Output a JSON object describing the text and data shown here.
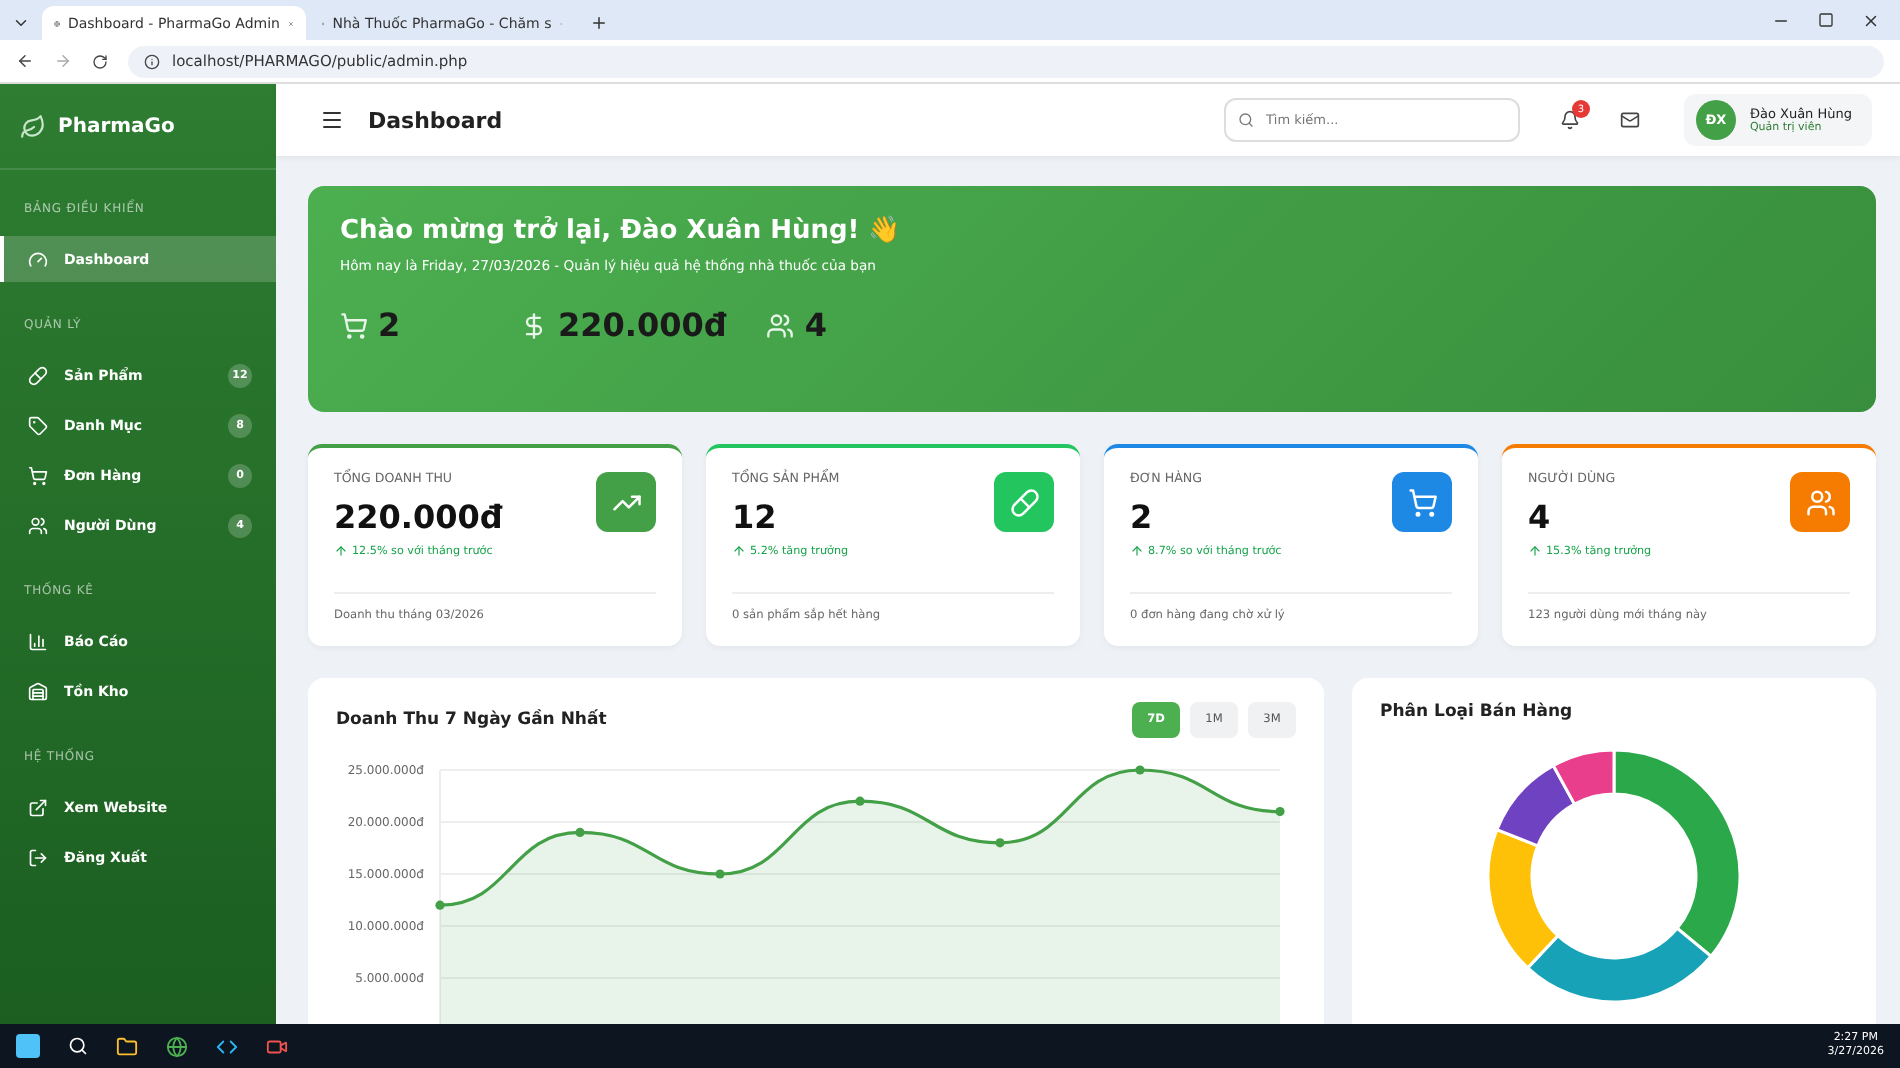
{
  "browser": {
    "tabs": [
      {
        "title": "Dashboard - PharmaGo Admin",
        "selected": true
      },
      {
        "title": "Nhà Thuốc PharmaGo - Chăm s",
        "selected": false
      }
    ],
    "address": "localhost/PHARMAGO/public/admin.php"
  },
  "sidebar": {
    "brand": "PharmaGo",
    "sections": [
      {
        "heading": "BẢNG ĐIỀU KHIỂN",
        "items": [
          {
            "kind": "dashboard",
            "label": "Dashboard",
            "selected": true
          }
        ]
      },
      {
        "heading": "QUẢN LÝ",
        "items": [
          {
            "kind": "products",
            "label": "Sản Phẩm",
            "badge": "12",
            "selected": false
          },
          {
            "kind": "categories",
            "label": "Danh Mục",
            "badge": "8",
            "selected": false
          },
          {
            "kind": "orders",
            "label": "Đơn Hàng",
            "badge": "0",
            "selected": false
          },
          {
            "kind": "users",
            "label": "Người Dùng",
            "badge": "4",
            "selected": false
          }
        ]
      },
      {
        "heading": "THỐNG KÊ",
        "items": [
          {
            "kind": "reports",
            "label": "Báo Cáo",
            "selected": false
          },
          {
            "kind": "inventory",
            "label": "Tồn Kho",
            "selected": false
          }
        ]
      },
      {
        "heading": "HỆ THỐNG",
        "items": [
          {
            "kind": "website",
            "label": "Xem Website",
            "selected": false
          },
          {
            "kind": "logout",
            "label": "Đăng Xuất",
            "selected": false
          }
        ]
      }
    ]
  },
  "header": {
    "title": "Dashboard",
    "search": {
      "placeholder": "Tìm kiếm..."
    },
    "notification_count": "3",
    "user": {
      "initials": "ĐX",
      "name": "Đào Xuân Hùng",
      "role": "Quản trị viên"
    }
  },
  "hero": {
    "title": "Chào mừng trở lại, Đào Xuân Hùng! 👋",
    "subtitle": "Hôm nay là Friday, 27/03/2026 - Quản lý hiệu quả hệ thống nhà thuốc của bạn",
    "stats": [
      {
        "kind": "orders",
        "value": "2"
      },
      {
        "kind": "revenue",
        "value": "220.000đ"
      },
      {
        "kind": "users",
        "value": "4"
      }
    ]
  },
  "cards": [
    {
      "kind": "revenue",
      "label": "TỔNG DOANH THU",
      "value": "220.000đ",
      "trend": "12.5% so với tháng trước",
      "footer": "Doanh thu tháng 03/2026",
      "color": "#43a047"
    },
    {
      "kind": "products",
      "label": "TỔNG SẢN PHẨM",
      "value": "12",
      "trend": "5.2% tăng trưởng",
      "footer": "0 sản phẩm sắp hết hàng",
      "color": "#22c55e"
    },
    {
      "kind": "orders",
      "label": "ĐƠN HÀNG",
      "value": "2",
      "trend": "8.7% so với tháng trước",
      "footer": "0 đơn hàng đang chờ xử lý",
      "color": "#1e88e5"
    },
    {
      "kind": "users",
      "label": "NGƯỜI DÙNG",
      "value": "4",
      "trend": "15.3% tăng trưởng",
      "footer": "123 người dùng mới tháng này",
      "color": "#f57c00"
    }
  ],
  "revenue_chart": {
    "title": "Doanh Thu 7 Ngày Gần Nhất",
    "ranges": [
      {
        "label": "7D",
        "selected": true
      },
      {
        "label": "1M",
        "selected": false
      },
      {
        "label": "3M",
        "selected": false
      }
    ],
    "chart_data": {
      "type": "area",
      "grid": true,
      "ylim": [
        0,
        25000000
      ],
      "yticks": [
        {
          "value": 5000000,
          "label": "5.000.000đ"
        },
        {
          "value": 10000000,
          "label": "10.000.000đ"
        },
        {
          "value": 15000000,
          "label": "15.000.000đ"
        },
        {
          "value": 20000000,
          "label": "20.000.000đ"
        },
        {
          "value": 25000000,
          "label": "25.000.000đ"
        }
      ],
      "series": [
        {
          "color": "#43a047",
          "values": [
            12000000,
            19000000,
            15000000,
            22000000,
            18000000,
            25000000,
            21000000
          ]
        }
      ]
    }
  },
  "category_chart": {
    "title": "Phân Loại Bán Hàng"
  },
  "taskbar": {
    "time": "2:27 PM",
    "date": "3/27/2026"
  }
}
